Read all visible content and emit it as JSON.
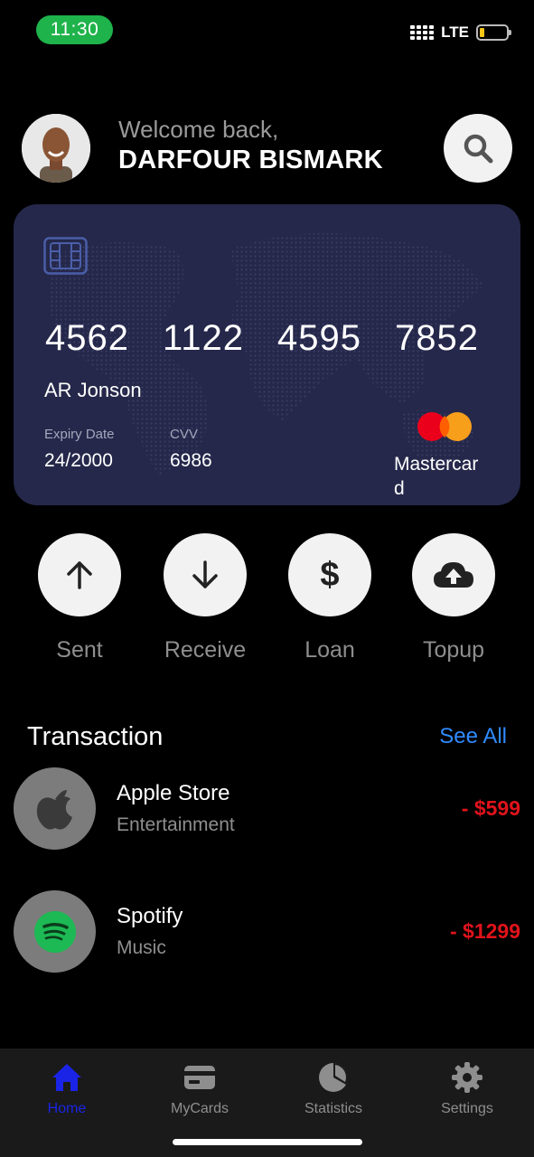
{
  "status_bar": {
    "time": "11:30",
    "network": "LTE",
    "colors": {
      "time_pill": "#1fb34b",
      "battery_fill": "#f5c518"
    }
  },
  "header": {
    "welcome": "Welcome back,",
    "username": "DARFOUR BISMARK",
    "avatar_icon": "user-avatar",
    "search_icon": "search-icon"
  },
  "card": {
    "number_groups": [
      "4562",
      "1122",
      "4595",
      "7852"
    ],
    "holder": "AR Jonson",
    "expiry_label": "Expiry Date",
    "expiry_value": "24/2000",
    "cvv_label": "CVV",
    "cvv_value": "6986",
    "brand": "Mastercard",
    "colors": {
      "background": "#25284a",
      "mc_red": "#eb001b",
      "mc_orange": "#f79e1b"
    }
  },
  "actions": [
    {
      "label": "Sent",
      "icon": "arrow-up-icon"
    },
    {
      "label": "Receive",
      "icon": "arrow-down-icon"
    },
    {
      "label": "Loan",
      "icon": "dollar-icon"
    },
    {
      "label": "Topup",
      "icon": "cloud-upload-icon"
    }
  ],
  "transactions": {
    "title": "Transaction",
    "see_all": "See All",
    "items": [
      {
        "name": "Apple Store",
        "category": "Entertainment",
        "amount": "- $599",
        "icon": "apple-icon"
      },
      {
        "name": "Spotify",
        "category": "Music",
        "amount": "- $1299",
        "icon": "spotify-icon"
      }
    ],
    "colors": {
      "amount": "#e0131b",
      "link": "#2f8bff"
    }
  },
  "bottom_nav": {
    "items": [
      {
        "label": "Home",
        "icon": "home-icon",
        "active": true
      },
      {
        "label": "MyCards",
        "icon": "card-icon",
        "active": false
      },
      {
        "label": "Statistics",
        "icon": "pie-chart-icon",
        "active": false
      },
      {
        "label": "Settings",
        "icon": "gear-icon",
        "active": false
      }
    ],
    "colors": {
      "active": "#1a24e6",
      "inactive": "#8e8e8e"
    }
  }
}
